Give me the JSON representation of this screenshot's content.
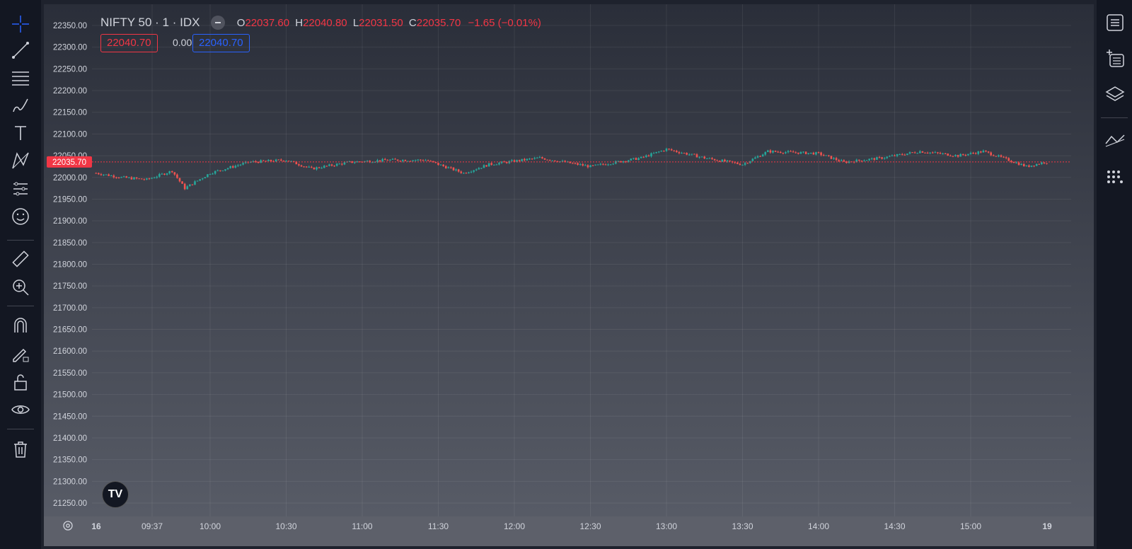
{
  "symbol": {
    "name": "NIFTY 50",
    "interval": "1",
    "exchange": "IDX",
    "title": "NIFTY 50 · 1 · IDX"
  },
  "ohlc": {
    "o_label": "O",
    "o": "22037.60",
    "h_label": "H",
    "h": "22040.80",
    "l_label": "L",
    "l": "22031.50",
    "c_label": "C",
    "c": "22035.70",
    "change": "−1.65 (−0.01%)"
  },
  "trade": {
    "sell": "22040.70",
    "spread": "0.00",
    "buy": "22040.70"
  },
  "last_price_label": "22035.70",
  "colors": {
    "up": "#26a69a",
    "down": "#ef5350",
    "accent": "#2962ff"
  },
  "left_toolbar_icons": [
    "crosshair-icon",
    "trend-line-icon",
    "fib-icon",
    "brush-icon",
    "text-icon",
    "pattern-icon",
    "forecast-icon",
    "emoji-icon",
    "ruler-icon",
    "zoom-in-icon",
    "magnet-icon",
    "lock-drawing-icon",
    "unlock-icon",
    "eye-icon",
    "trash-icon"
  ],
  "right_toolbar_icons": [
    "watchlist-icon",
    "add-watchlist-icon",
    "layers-icon",
    "indicator-icon",
    "dots-icon"
  ],
  "chart_data": {
    "type": "candlestick",
    "y_ticks": [
      22350,
      22300,
      22250,
      22200,
      22150,
      22100,
      22050,
      22000,
      21950,
      21900,
      21850,
      21800,
      21750,
      21700,
      21650,
      21600,
      21550,
      21500,
      21450,
      21400,
      21350,
      21300,
      21250
    ],
    "ylim": [
      21225,
      22375
    ],
    "x_ticks": [
      "16",
      "09:37",
      "10:00",
      "10:30",
      "11:00",
      "11:30",
      "12:00",
      "12:30",
      "13:00",
      "13:30",
      "14:00",
      "14:30",
      "15:00",
      "19"
    ],
    "last_price": 22035.7,
    "series_points": [
      {
        "t": "09:15",
        "v": 22010
      },
      {
        "t": "09:25",
        "v": 22000
      },
      {
        "t": "09:35",
        "v": 21995
      },
      {
        "t": "09:45",
        "v": 22015
      },
      {
        "t": "09:50",
        "v": 21975
      },
      {
        "t": "10:00",
        "v": 22010
      },
      {
        "t": "10:15",
        "v": 22035
      },
      {
        "t": "10:30",
        "v": 22040
      },
      {
        "t": "10:40",
        "v": 22020
      },
      {
        "t": "10:55",
        "v": 22035
      },
      {
        "t": "11:10",
        "v": 22040
      },
      {
        "t": "11:25",
        "v": 22040
      },
      {
        "t": "11:40",
        "v": 22010
      },
      {
        "t": "11:50",
        "v": 22030
      },
      {
        "t": "12:10",
        "v": 22045
      },
      {
        "t": "12:30",
        "v": 22025
      },
      {
        "t": "12:50",
        "v": 22045
      },
      {
        "t": "13:00",
        "v": 22065
      },
      {
        "t": "13:15",
        "v": 22045
      },
      {
        "t": "13:30",
        "v": 22030
      },
      {
        "t": "13:40",
        "v": 22060
      },
      {
        "t": "14:00",
        "v": 22055
      },
      {
        "t": "14:10",
        "v": 22035
      },
      {
        "t": "14:25",
        "v": 22045
      },
      {
        "t": "14:40",
        "v": 22060
      },
      {
        "t": "14:55",
        "v": 22050
      },
      {
        "t": "15:05",
        "v": 22060
      },
      {
        "t": "15:15",
        "v": 22040
      },
      {
        "t": "15:22",
        "v": 22025
      },
      {
        "t": "15:29",
        "v": 22035
      }
    ]
  }
}
